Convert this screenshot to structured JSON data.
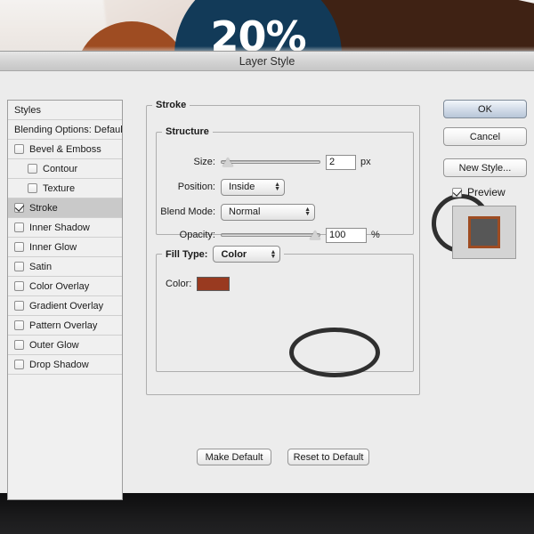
{
  "backdrop": {
    "badge_text": "20%",
    "navy": "#123a58",
    "brown": "#9e4c22",
    "dark_brown": "#3f2214"
  },
  "dialog": {
    "title": "Layer Style"
  },
  "styles_list": {
    "items": [
      {
        "label": "Styles",
        "type": "header",
        "checked": false,
        "indent": false,
        "selected": false
      },
      {
        "label": "Blending Options: Default",
        "type": "header",
        "checked": false,
        "indent": false,
        "selected": false
      },
      {
        "label": "Bevel & Emboss",
        "type": "effect",
        "checked": false,
        "indent": false,
        "selected": false
      },
      {
        "label": "Contour",
        "type": "effect",
        "checked": false,
        "indent": true,
        "selected": false
      },
      {
        "label": "Texture",
        "type": "effect",
        "checked": false,
        "indent": true,
        "selected": false
      },
      {
        "label": "Stroke",
        "type": "effect",
        "checked": true,
        "indent": false,
        "selected": true
      },
      {
        "label": "Inner Shadow",
        "type": "effect",
        "checked": false,
        "indent": false,
        "selected": false
      },
      {
        "label": "Inner Glow",
        "type": "effect",
        "checked": false,
        "indent": false,
        "selected": false
      },
      {
        "label": "Satin",
        "type": "effect",
        "checked": false,
        "indent": false,
        "selected": false
      },
      {
        "label": "Color Overlay",
        "type": "effect",
        "checked": false,
        "indent": false,
        "selected": false
      },
      {
        "label": "Gradient Overlay",
        "type": "effect",
        "checked": false,
        "indent": false,
        "selected": false
      },
      {
        "label": "Pattern Overlay",
        "type": "effect",
        "checked": false,
        "indent": false,
        "selected": false
      },
      {
        "label": "Outer Glow",
        "type": "effect",
        "checked": false,
        "indent": false,
        "selected": false
      },
      {
        "label": "Drop Shadow",
        "type": "effect",
        "checked": false,
        "indent": false,
        "selected": false
      }
    ]
  },
  "stroke_panel": {
    "legend": "Stroke",
    "structure": {
      "legend": "Structure",
      "size": {
        "label": "Size:",
        "value": "2",
        "unit": "px",
        "slider_pct": 2
      },
      "position": {
        "label": "Position:",
        "value": "Inside"
      },
      "blend_mode": {
        "label": "Blend Mode:",
        "value": "Normal"
      },
      "opacity": {
        "label": "Opacity:",
        "value": "100",
        "unit": "%",
        "slider_pct": 100
      }
    },
    "fill_type": {
      "legend": "Fill Type:",
      "value": "Color",
      "color": {
        "label": "Color:",
        "hex": "#993A20"
      }
    }
  },
  "footer_buttons": {
    "make_default": "Make Default",
    "reset_to_default": "Reset to Default"
  },
  "right_column": {
    "ok": "OK",
    "cancel": "Cancel",
    "new_style": "New Style...",
    "preview_label": "Preview",
    "preview_checked": true,
    "preview_swatch": {
      "fill": "#575757",
      "stroke": "#9E4C22"
    }
  }
}
